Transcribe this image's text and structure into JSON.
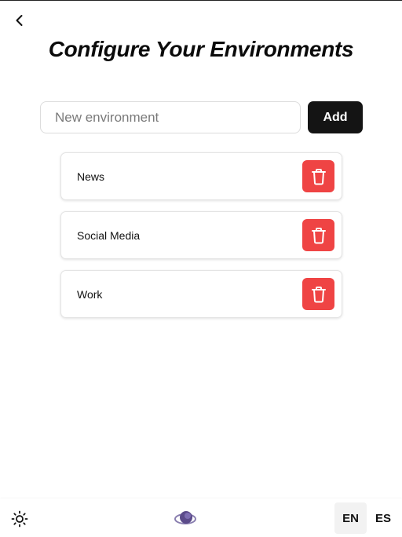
{
  "header": {
    "back_icon": "chevron-left-icon",
    "title": "Configure Your Environments"
  },
  "add_form": {
    "input_value": "",
    "input_placeholder": "New environment",
    "add_label": "Add"
  },
  "environments": [
    {
      "name": "News",
      "delete_icon": "trash-icon"
    },
    {
      "name": "Social Media",
      "delete_icon": "trash-icon"
    },
    {
      "name": "Work",
      "delete_icon": "trash-icon"
    }
  ],
  "footer": {
    "theme_icon": "sun-icon",
    "logo_icon": "app-logo-icon",
    "languages": [
      {
        "code": "EN",
        "selected": true
      },
      {
        "code": "ES",
        "selected": false
      }
    ]
  },
  "colors": {
    "delete": "#ef4444",
    "add_button": "#141414",
    "logo": "#5b4b8a",
    "selected_lang_bg": "#f2f2f2"
  }
}
